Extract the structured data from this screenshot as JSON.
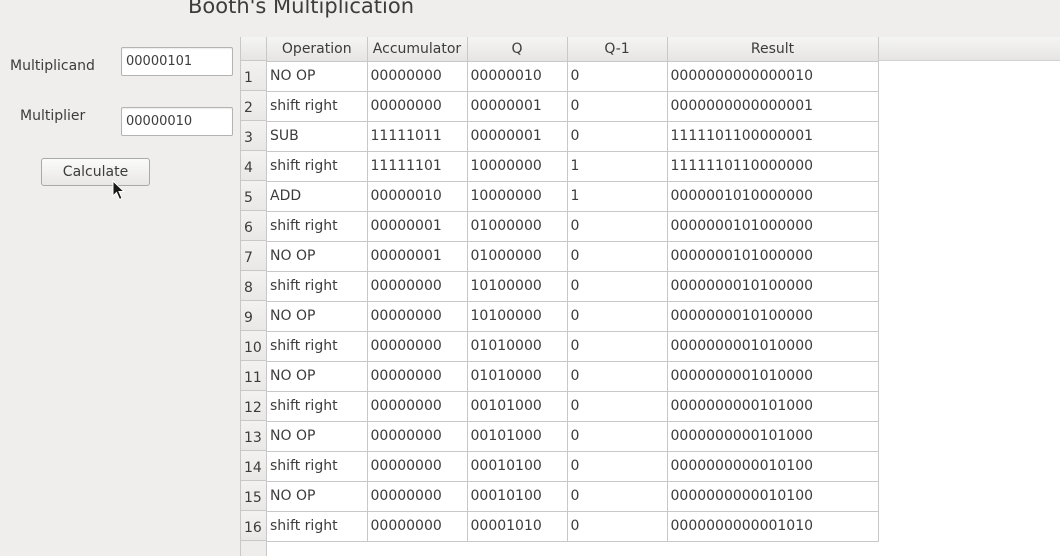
{
  "title": "Booth's Multiplication",
  "form": {
    "multiplicand_label": "Multiplicand",
    "multiplicand_value": "00000101",
    "multiplier_label": "Multiplier",
    "multiplier_value": "00000010",
    "calculate_label": "Calculate"
  },
  "table": {
    "headers": [
      "Operation",
      "Accumulator",
      "Q",
      "Q-1",
      "Result"
    ],
    "rows": [
      {
        "num": "1",
        "op": "NO OP",
        "acc": "00000000",
        "q": "00000010",
        "q1": "0",
        "result": "0000000000000010"
      },
      {
        "num": "2",
        "op": "shift right",
        "acc": "00000000",
        "q": "00000001",
        "q1": "0",
        "result": "0000000000000001"
      },
      {
        "num": "3",
        "op": "SUB",
        "acc": "11111011",
        "q": "00000001",
        "q1": "0",
        "result": "1111101100000001"
      },
      {
        "num": "4",
        "op": "shift right",
        "acc": "11111101",
        "q": "10000000",
        "q1": "1",
        "result": "1111110110000000"
      },
      {
        "num": "5",
        "op": "ADD",
        "acc": "00000010",
        "q": "10000000",
        "q1": "1",
        "result": "0000001010000000"
      },
      {
        "num": "6",
        "op": "shift right",
        "acc": "00000001",
        "q": "01000000",
        "q1": "0",
        "result": "0000000101000000"
      },
      {
        "num": "7",
        "op": "NO OP",
        "acc": "00000001",
        "q": "01000000",
        "q1": "0",
        "result": "0000000101000000"
      },
      {
        "num": "8",
        "op": "shift right",
        "acc": "00000000",
        "q": "10100000",
        "q1": "0",
        "result": "0000000010100000"
      },
      {
        "num": "9",
        "op": "NO OP",
        "acc": "00000000",
        "q": "10100000",
        "q1": "0",
        "result": "0000000010100000"
      },
      {
        "num": "10",
        "op": "shift right",
        "acc": "00000000",
        "q": "01010000",
        "q1": "0",
        "result": "0000000001010000"
      },
      {
        "num": "11",
        "op": "NO OP",
        "acc": "00000000",
        "q": "01010000",
        "q1": "0",
        "result": "0000000001010000"
      },
      {
        "num": "12",
        "op": "shift right",
        "acc": "00000000",
        "q": "00101000",
        "q1": "0",
        "result": "0000000000101000"
      },
      {
        "num": "13",
        "op": "NO OP",
        "acc": "00000000",
        "q": "00101000",
        "q1": "0",
        "result": "0000000000101000"
      },
      {
        "num": "14",
        "op": "shift right",
        "acc": "00000000",
        "q": "00010100",
        "q1": "0",
        "result": "0000000000010100"
      },
      {
        "num": "15",
        "op": "NO OP",
        "acc": "00000000",
        "q": "00010100",
        "q1": "0",
        "result": "0000000000010100"
      },
      {
        "num": "16",
        "op": "shift right",
        "acc": "00000000",
        "q": "00001010",
        "q1": "0",
        "result": "0000000000001010"
      }
    ]
  },
  "icons": {
    "cursor": "mouse-pointer-icon"
  }
}
